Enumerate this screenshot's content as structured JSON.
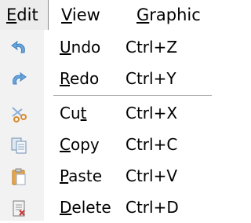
{
  "menubar": {
    "edit": {
      "pre": "",
      "mn": "E",
      "post": "dit"
    },
    "view": {
      "pre": "",
      "mn": "V",
      "post": "iew"
    },
    "graphic": {
      "pre": "",
      "mn": "G",
      "post": "raphic"
    }
  },
  "edit_menu": {
    "items": [
      {
        "icon": "undo-icon",
        "pre": "",
        "mn": "U",
        "post": "ndo",
        "shortcut": "Ctrl+Z"
      },
      {
        "icon": "redo-icon",
        "pre": "",
        "mn": "R",
        "post": "edo",
        "shortcut": "Ctrl+Y"
      },
      {
        "icon": "cut-icon",
        "pre": "Cu",
        "mn": "t",
        "post": "",
        "shortcut": "Ctrl+X"
      },
      {
        "icon": "copy-icon",
        "pre": "",
        "mn": "C",
        "post": "opy",
        "shortcut": "Ctrl+C"
      },
      {
        "icon": "paste-icon",
        "pre": "",
        "mn": "P",
        "post": "aste",
        "shortcut": "Ctrl+V"
      },
      {
        "icon": "delete-icon",
        "pre": "",
        "mn": "D",
        "post": "elete",
        "shortcut": "Ctrl+D"
      }
    ]
  }
}
